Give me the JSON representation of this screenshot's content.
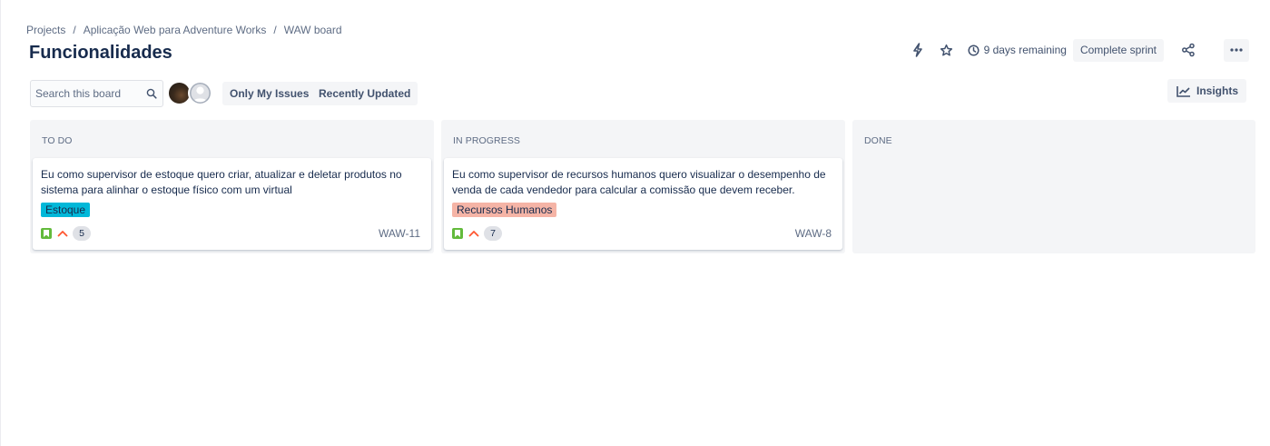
{
  "breadcrumb": {
    "items": [
      "Projects",
      "Aplicação Web para Adventure Works",
      "WAW board"
    ],
    "separator": "/"
  },
  "page_title": "Funcionalidades",
  "header": {
    "remaining": "9 days remaining",
    "complete_sprint": "Complete sprint",
    "icons": [
      "automation-icon",
      "star-icon",
      "clock-icon",
      "share-icon",
      "more-icon"
    ]
  },
  "toolbar": {
    "search_placeholder": "Search this board",
    "only_my_issues": "Only My Issues",
    "recently_updated": "Recently Updated",
    "insights": "Insights"
  },
  "columns": [
    {
      "title": "TO DO",
      "cards": [
        {
          "summary": "Eu como supervisor de estoque quero criar, atualizar e deletar produtos no sistema para alinhar o estoque físico com um virtual",
          "label": "Estoque",
          "label_color": "#00b8d9",
          "points": "5",
          "key": "WAW-11"
        }
      ]
    },
    {
      "title": "IN PROGRESS",
      "cards": [
        {
          "summary": "Eu como supervisor de recursos humanos quero visualizar o desempenho de venda de cada vendedor para calcular a comissão que devem receber.",
          "label": "Recursos Humanos",
          "label_color": "#f5b4a6",
          "points": "7",
          "key": "WAW-8"
        }
      ]
    },
    {
      "title": "DONE",
      "cards": []
    }
  ],
  "colors": {
    "story": "#63ba3c",
    "priority_high": "#ff5630",
    "column_bg": "#f4f5f7"
  }
}
